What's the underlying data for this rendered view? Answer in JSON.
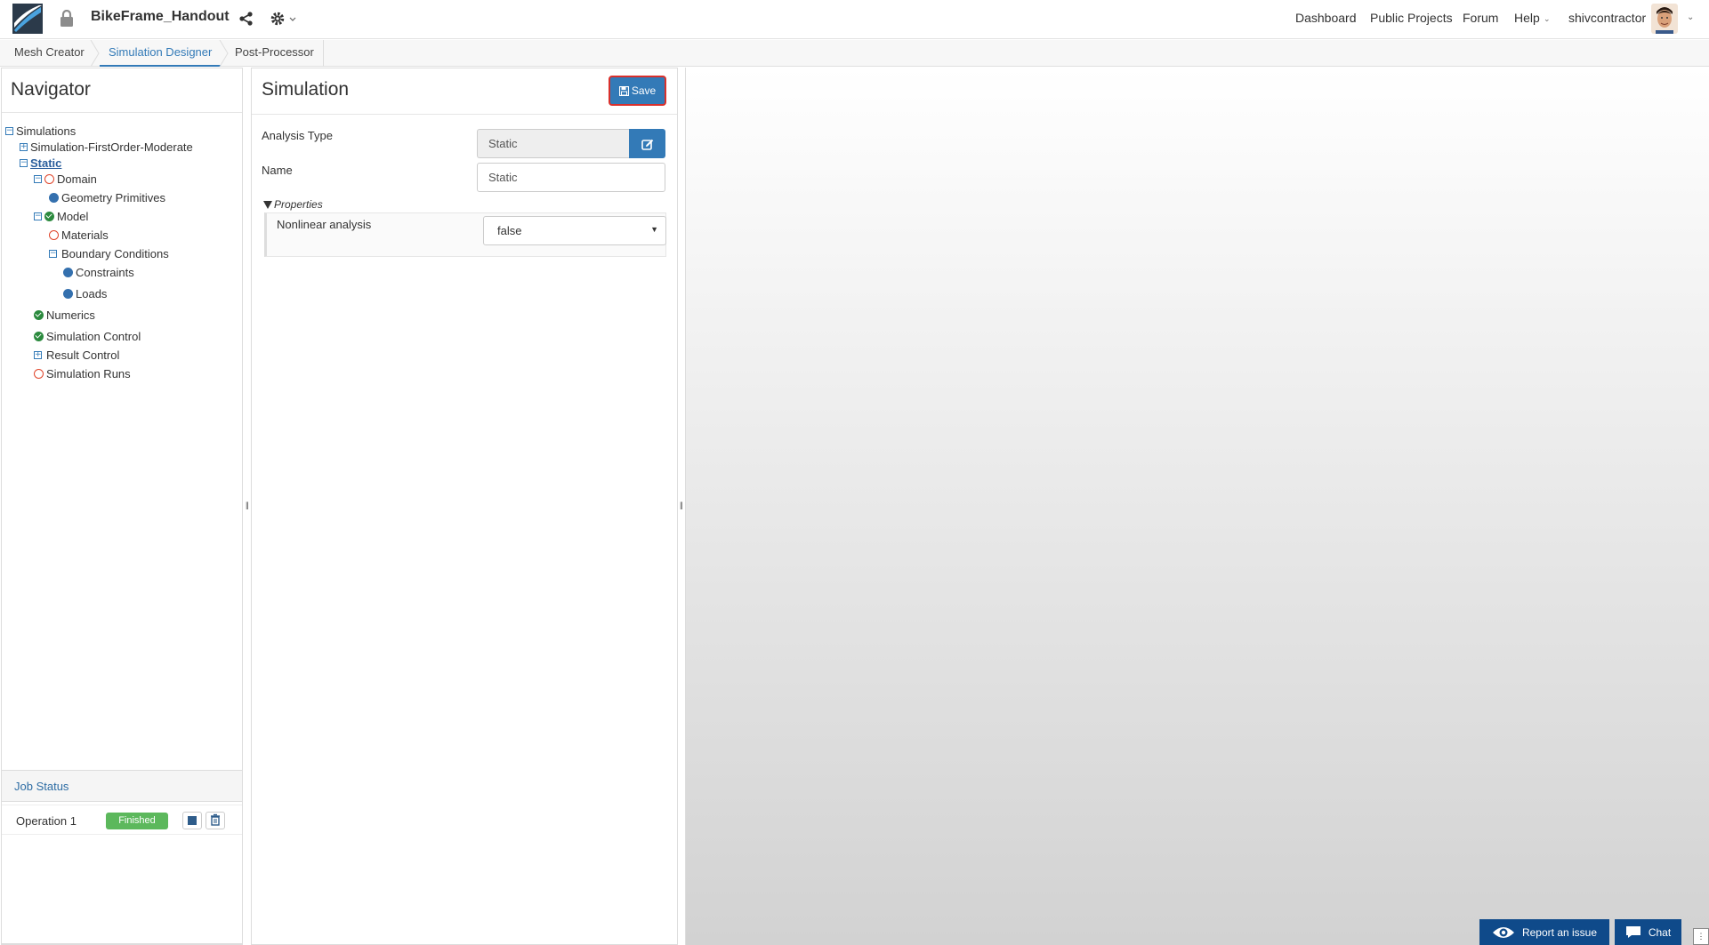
{
  "header": {
    "project_title": "BikeFrame_Handout",
    "nav": {
      "dashboard": "Dashboard",
      "public_projects": "Public Projects",
      "forum": "Forum",
      "help": "Help",
      "username": "shivcontractor"
    }
  },
  "tabs": [
    "Mesh Creator",
    "Simulation Designer",
    "Post-Processor"
  ],
  "navigator": {
    "title": "Navigator",
    "tree": {
      "simulations": "Simulations",
      "sim_first_order": "Simulation-FirstOrder-Moderate",
      "static": "Static",
      "domain": "Domain",
      "geometry_primitives": "Geometry Primitives",
      "model": "Model",
      "materials": "Materials",
      "boundary_conditions": "Boundary Conditions",
      "constraints": "Constraints",
      "loads": "Loads",
      "numerics": "Numerics",
      "simulation_control": "Simulation Control",
      "result_control": "Result Control",
      "simulation_runs": "Simulation Runs"
    }
  },
  "job_status": {
    "title": "Job Status",
    "operation": "Operation 1",
    "status": "Finished"
  },
  "simulation": {
    "title": "Simulation",
    "save_label": "Save",
    "analysis_type_label": "Analysis Type",
    "analysis_type_value": "Static",
    "name_label": "Name",
    "name_value": "Static",
    "properties_label": "Properties",
    "nonlinear_label": "Nonlinear analysis",
    "nonlinear_value": "false"
  },
  "footer": {
    "report_label": "Report an issue",
    "chat_label": "Chat"
  },
  "colors": {
    "accent": "#337ab7",
    "success": "#5cb85c",
    "error_ring": "#e0452b",
    "check": "#2b8a3e",
    "footer_button": "#0f4a8a"
  }
}
